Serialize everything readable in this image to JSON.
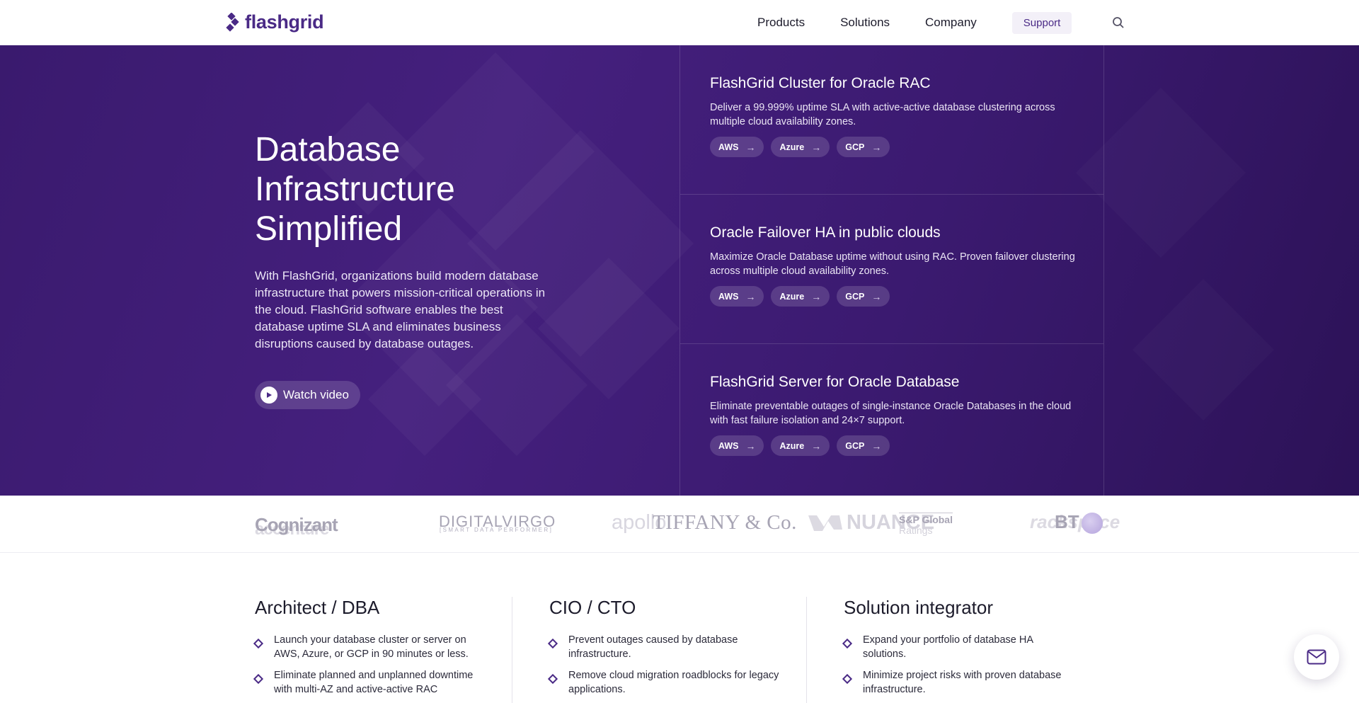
{
  "header": {
    "logo_text": "flashgrid",
    "nav": {
      "products": "Products",
      "solutions": "Solutions",
      "company": "Company",
      "support": "Support"
    }
  },
  "hero": {
    "title": "Database Infrastructure Simplified",
    "description": "With FlashGrid, organizations build modern database infrastructure that powers mission-critical operations in the cloud. FlashGrid software enables the best database uptime SLA and eliminates business disruptions caused by database outages.",
    "watch_video": "Watch video",
    "cards": [
      {
        "title": "FlashGrid Cluster for Oracle RAC",
        "description": "Deliver a 99.999% uptime SLA with active-active database clustering across multiple cloud availability zones.",
        "pills": [
          "AWS",
          "Azure",
          "GCP"
        ]
      },
      {
        "title": "Oracle Failover HA in public clouds",
        "description": "Maximize Oracle Database uptime without using RAC. Proven failover clustering across multiple cloud availability zones.",
        "pills": [
          "AWS",
          "Azure",
          "GCP"
        ]
      },
      {
        "title": "FlashGrid Server for Oracle Database",
        "description": "Eliminate preventable outages of single-instance Oracle Databases in the cloud with fast failure isolation and 24×7 support.",
        "pills": [
          "AWS",
          "Azure",
          "GCP"
        ]
      }
    ]
  },
  "customer_logos": {
    "cognizant": "Cognizant",
    "accenture": "accenture",
    "digital_virgo": "DIGITALVIRGO",
    "digital_virgo_tagline": "[SMART DATA PERFORMER]",
    "apollo": "apollo",
    "tiffany": "TIFFANY & Co.",
    "nuance": "NUANCE",
    "sp_global": "S&P Global",
    "sp_ratings": "Ratings",
    "rackspace": "rackspace",
    "bt": "BT"
  },
  "personas": [
    {
      "title": "Architect / DBA",
      "bullets": [
        "Launch your database cluster or server on AWS, Azure, or GCP in 90 minutes or less.",
        "Eliminate planned and unplanned downtime with multi-AZ and active-active RAC"
      ]
    },
    {
      "title": "CIO / CTO",
      "bullets": [
        "Prevent outages caused by database infrastructure.",
        "Remove cloud migration roadblocks for legacy applications."
      ]
    },
    {
      "title": "Solution integrator",
      "bullets": [
        "Expand your portfolio of database HA solutions.",
        "Minimize project risks with proven database infrastructure."
      ]
    }
  ],
  "colors": {
    "brand": "#4a2a86",
    "hero_bg": "#3d1c72"
  },
  "icons": {
    "search": "search-icon",
    "play": "play-icon",
    "arrow": "arrow-right-icon",
    "chat": "mail-icon"
  }
}
